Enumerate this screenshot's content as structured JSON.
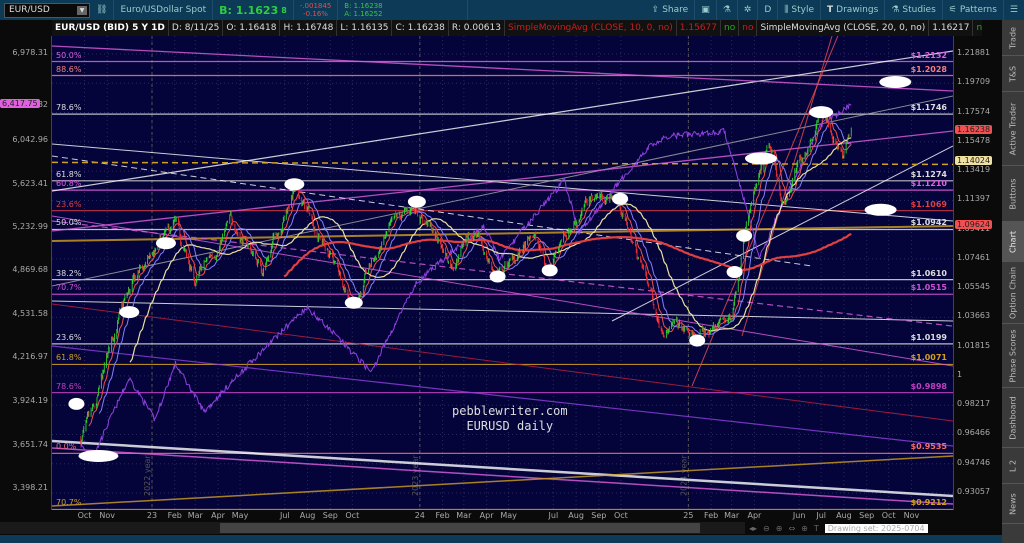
{
  "toolbar": {
    "symbol": "EUR/USD",
    "description": "Euro/USDollar Spot",
    "bid_label": "B: 1.1623",
    "bid_small": "8",
    "change": "-.001845",
    "change_pct": "-0.16%",
    "bid": "B: 1.16238",
    "ask": "A: 1.16252",
    "share": "Share",
    "period": "D",
    "style": "Style",
    "drawings": "Drawings",
    "studies": "Studies",
    "patterns": "Patterns"
  },
  "infobar": {
    "title": "EUR/USD (BID) 5 Y 1D",
    "date": "D: 8/11/25",
    "open": "O: 1.16418",
    "high": "H: 1.16748",
    "low": "L: 1.16135",
    "close": "C: 1.16238",
    "range": "R: 0.00613",
    "sma1": "SimpleMovingAvg (CLOSE, 10, 0, no)",
    "sma1_val": "1.15677",
    "sma2": "SimpleMovingAvg (CLOSE, 20, 0, no)",
    "sma2_val": "1.16217",
    "no": "no",
    "more": "..."
  },
  "left_axis": {
    "ticks": [
      "6,978.31",
      "6,403.82",
      "6,042.96",
      "5,623.41",
      "5,232.99",
      "4,869.68",
      "4,531.58",
      "4,216.97",
      "3,924.19",
      "3,651.74",
      "3,398.21"
    ],
    "badge": "6,417.75",
    "badge_color": "#e060e0"
  },
  "right_axis": {
    "ticks": [
      "1.21881",
      "1.19709",
      "1.17574",
      "1.15478",
      "1.13419",
      "1.11397",
      "1.09411",
      "1.07461",
      "1.05545",
      "1.03663",
      "1.01815",
      "1",
      "0.98217",
      "0.96466",
      "0.94746",
      "0.93057"
    ],
    "badges": [
      {
        "text": "1.16238",
        "color": "#f05050",
        "price": 1.16238
      },
      {
        "text": "1.14024",
        "color": "#f0e0a0",
        "price": 1.14024
      },
      {
        "text": "1.09624",
        "color": "#f05050",
        "price": 1.09624
      }
    ]
  },
  "bottom_axis": {
    "labels": [
      [
        "Oct",
        "2022-10-01"
      ],
      [
        "Nov",
        "2022-11-01"
      ],
      [
        "23",
        "2023-01-01"
      ],
      [
        "Feb",
        "2023-02-01"
      ],
      [
        "Mar",
        "2023-03-01"
      ],
      [
        "Apr",
        "2023-04-01"
      ],
      [
        "May",
        "2023-05-01"
      ],
      [
        "Jul",
        "2023-07-01"
      ],
      [
        "Aug",
        "2023-08-01"
      ],
      [
        "Sep",
        "2023-09-01"
      ],
      [
        "Oct",
        "2023-10-01"
      ],
      [
        "24",
        "2024-01-01"
      ],
      [
        "Feb",
        "2024-02-01"
      ],
      [
        "Mar",
        "2024-03-01"
      ],
      [
        "Apr",
        "2024-04-01"
      ],
      [
        "May",
        "2024-05-01"
      ],
      [
        "Jul",
        "2024-07-01"
      ],
      [
        "Aug",
        "2024-08-01"
      ],
      [
        "Sep",
        "2024-09-01"
      ],
      [
        "Oct",
        "2024-10-01"
      ],
      [
        "25",
        "2025-01-01"
      ],
      [
        "Feb",
        "2025-02-01"
      ],
      [
        "Mar",
        "2025-03-01"
      ],
      [
        "Apr",
        "2025-04-01"
      ],
      [
        "Jun",
        "2025-06-01"
      ],
      [
        "Jul",
        "2025-07-01"
      ],
      [
        "Aug",
        "2025-08-01"
      ],
      [
        "Sep",
        "2025-09-01"
      ],
      [
        "Oct",
        "2025-10-01"
      ],
      [
        "Nov",
        "2025-11-01"
      ]
    ]
  },
  "year_labels": [
    "2022 year",
    "2023 year",
    "2024 year"
  ],
  "watermark": {
    "line1": "pebblewriter.com",
    "line2": "EURUSD daily"
  },
  "fib_levels": [
    {
      "pct": "50.0%",
      "price_label": "$1.2132",
      "price": 1.2132,
      "color": "#e060e0"
    },
    {
      "pct": "88.6%",
      "price_label": "$1.2028",
      "price": 1.2028,
      "color": "#f08080"
    },
    {
      "pct": "78.6%",
      "price_label": "$1.1746",
      "price": 1.1746,
      "color": "#dddddd"
    },
    {
      "pct": "61.8%",
      "price_label": "$1.1274",
      "price": 1.1274,
      "color": "#dddddd"
    },
    {
      "pct": "60.8%",
      "price_label": "$1.1210",
      "price": 1.121,
      "color": "#e060e0"
    },
    {
      "pct": "23.6%",
      "price_label": "$1.1069",
      "price": 1.1069,
      "color": "#e04040"
    },
    {
      "pct": "50.0%",
      "price_label": "$1.0942",
      "price": 1.0942,
      "color": "#dddddd"
    },
    {
      "pct": "38.2%",
      "price_label": "$1.0610",
      "price": 1.061,
      "color": "#dddddd"
    },
    {
      "pct": "70.7%",
      "price_label": "$1.0515",
      "price": 1.0515,
      "color": "#d050d0"
    },
    {
      "pct": "23.6%",
      "price_label": "$1.0199",
      "price": 1.0199,
      "color": "#dddddd"
    },
    {
      "pct": "61.8%",
      "price_label": "$1.0071",
      "price": 1.0071,
      "color": "#d0a020"
    },
    {
      "pct": "78.6%",
      "price_label": "$0.9898",
      "price": 0.9898,
      "color": "#c040c0"
    },
    {
      "pct": "0.0%",
      "price_label": "$0.9535",
      "price": 0.9535,
      "color": "#f07070"
    },
    {
      "pct": "70.7%",
      "price_label": "$0.9212",
      "price": 0.9212,
      "color": "#d0a020"
    }
  ],
  "sidebar": {
    "tabs": [
      "Trade",
      "T&S",
      "Active Trader",
      "Buttons",
      "Chart",
      "Option Chain",
      "Phase Scores",
      "Dashboard",
      "L 2",
      "News"
    ],
    "active": "Chart"
  },
  "bottom_tools": {
    "drawing_set": "Drawing set: 2025-0704"
  },
  "colors": {
    "up": "#30d030",
    "down": "#f03030",
    "sma10": "#f05050",
    "sma20": "#8080ff",
    "sma50": "#e8e0a0",
    "sma200": "#e04040",
    "overlay": "#9040e0"
  },
  "chart_data": {
    "type": "candlestick",
    "title": "EUR/USD (BID) 5 Y 1D",
    "price_range": [
      0.93057,
      1.21881
    ],
    "overlay_range": [
      3398.21,
      6978.31
    ],
    "eurusd_close": [
      [
        "2022-09-26",
        0.962
      ],
      [
        "2022-10-15",
        0.975
      ],
      [
        "2022-11-15",
        1.035
      ],
      [
        "2022-12-15",
        1.065
      ],
      [
        "2023-02-01",
        1.095
      ],
      [
        "2023-03-01",
        1.058
      ],
      [
        "2023-04-20",
        1.1
      ],
      [
        "2023-05-31",
        1.068
      ],
      [
        "2023-07-14",
        1.122
      ],
      [
        "2023-08-20",
        1.088
      ],
      [
        "2023-10-03",
        1.047
      ],
      [
        "2023-11-20",
        1.092
      ],
      [
        "2023-12-28",
        1.11
      ],
      [
        "2024-02-14",
        1.072
      ],
      [
        "2024-03-08",
        1.094
      ],
      [
        "2024-04-16",
        1.063
      ],
      [
        "2024-06-05",
        1.088
      ],
      [
        "2024-06-26",
        1.068
      ],
      [
        "2024-07-17",
        1.093
      ],
      [
        "2024-08-26",
        1.118
      ],
      [
        "2024-09-25",
        1.116
      ],
      [
        "2024-10-23",
        1.078
      ],
      [
        "2024-11-22",
        1.036
      ],
      [
        "2025-01-13",
        1.022
      ],
      [
        "2025-02-28",
        1.038
      ],
      [
        "2025-03-18",
        1.092
      ],
      [
        "2025-04-21",
        1.148
      ],
      [
        "2025-05-12",
        1.11
      ],
      [
        "2025-06-13",
        1.154
      ],
      [
        "2025-07-01",
        1.18
      ],
      [
        "2025-07-31",
        1.142
      ],
      [
        "2025-08-11",
        1.1624
      ]
    ],
    "spx_overlay": [
      [
        "2022-09-26",
        3650
      ],
      [
        "2022-10-13",
        3580
      ],
      [
        "2022-12-01",
        4080
      ],
      [
        "2023-01-05",
        3810
      ],
      [
        "2023-02-02",
        4180
      ],
      [
        "2023-03-13",
        3860
      ],
      [
        "2023-07-31",
        4590
      ],
      [
        "2023-10-27",
        4120
      ],
      [
        "2023-12-28",
        4780
      ],
      [
        "2024-03-28",
        5250
      ],
      [
        "2024-04-19",
        4970
      ],
      [
        "2024-07-16",
        5660
      ],
      [
        "2024-08-05",
        5190
      ],
      [
        "2024-11-11",
        6000
      ],
      [
        "2024-12-06",
        6090
      ],
      [
        "2025-02-19",
        6140
      ],
      [
        "2025-04-08",
        4980
      ],
      [
        "2025-06-30",
        6200
      ],
      [
        "2025-08-11",
        6417.75
      ]
    ],
    "sma_periods": [
      10,
      20,
      50,
      200
    ]
  }
}
